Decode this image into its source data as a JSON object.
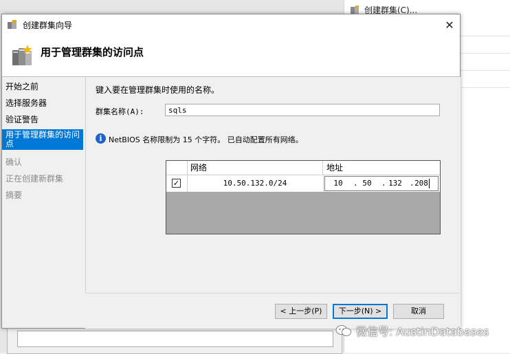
{
  "background": {
    "action_label": "创建群集(C)..."
  },
  "dialog": {
    "title": "创建群集向导",
    "header_title": "用于管理群集的访问点",
    "nav_items": [
      {
        "label": "开始之前"
      },
      {
        "label": "选择服务器"
      },
      {
        "label": "验证警告"
      },
      {
        "label": "用于管理群集的访问点"
      },
      {
        "label": "确认"
      },
      {
        "label": "正在创建新群集"
      },
      {
        "label": "摘要"
      }
    ],
    "prompt": "键入要在管理群集时使用的名称。",
    "name_label": "群集名称(A):",
    "name_value": "sqls",
    "info_text": "NetBIOS 名称限制为 15 个字符。 已自动配置所有网络。",
    "grid": {
      "headers": {
        "network": "网络",
        "address": "地址"
      },
      "rows": [
        {
          "checked": "✓",
          "network": "10.50.132.0/24",
          "address": [
            "10",
            "50",
            "132",
            "208"
          ]
        }
      ]
    },
    "buttons": {
      "prev": "< 上一步(P)",
      "next": "下一步(N) >",
      "cancel": "取消"
    }
  },
  "watermark": "微信号: AustinDatabases",
  "colors": {
    "selection": "#0078d7",
    "info": "#1d63c8",
    "grid_empty": "#a8a8a8"
  }
}
